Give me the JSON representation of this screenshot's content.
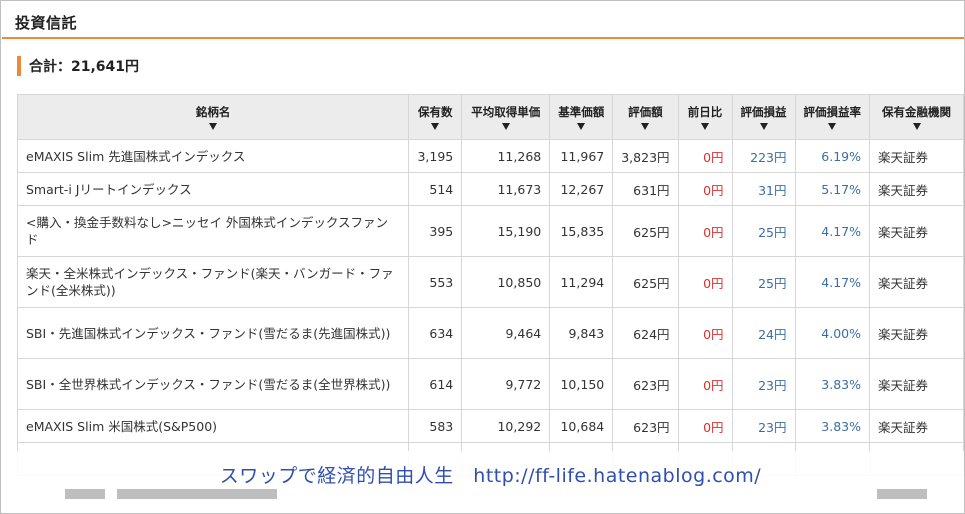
{
  "section": {
    "title": "投資信託"
  },
  "total": {
    "label": "合計：21,641円"
  },
  "columns": [
    "銘柄名",
    "保有数",
    "平均取得単価",
    "基準価額",
    "評価額",
    "前日比",
    "評価損益",
    "評価損益率",
    "保有金融機関"
  ],
  "rows": [
    {
      "name": "eMAXIS Slim 先進国株式インデックス",
      "qty": "3,195",
      "avg": "11,268",
      "nav": "11,967",
      "value": "3,823円",
      "change": "0円",
      "pl": "223円",
      "rate": "6.19%",
      "inst": "楽天証券"
    },
    {
      "name": "Smart-i Jリートインデックス",
      "qty": "514",
      "avg": "11,673",
      "nav": "12,267",
      "value": "631円",
      "change": "0円",
      "pl": "31円",
      "rate": "5.17%",
      "inst": "楽天証券"
    },
    {
      "name": "<購入・換金手数料なし>ニッセイ 外国株式インデックスファンド",
      "qty": "395",
      "avg": "15,190",
      "nav": "15,835",
      "value": "625円",
      "change": "0円",
      "pl": "25円",
      "rate": "4.17%",
      "inst": "楽天証券"
    },
    {
      "name": "楽天・全米株式インデックス・ファンド(楽天・バンガード・ファンド(全米株式))",
      "qty": "553",
      "avg": "10,850",
      "nav": "11,294",
      "value": "625円",
      "change": "0円",
      "pl": "25円",
      "rate": "4.17%",
      "inst": "楽天証券"
    },
    {
      "name": "SBI・先進国株式インデックス・ファンド(雪だるま(先進国株式))",
      "qty": "634",
      "avg": "9,464",
      "nav": "9,843",
      "value": "624円",
      "change": "0円",
      "pl": "24円",
      "rate": "4.00%",
      "inst": "楽天証券"
    },
    {
      "name": "SBI・全世界株式インデックス・ファンド(雪だるま(全世界株式))",
      "qty": "614",
      "avg": "9,772",
      "nav": "10,150",
      "value": "623円",
      "change": "0円",
      "pl": "23円",
      "rate": "3.83%",
      "inst": "楽天証券"
    },
    {
      "name": "eMAXIS Slim 米国株式(S&P500)",
      "qty": "583",
      "avg": "10,292",
      "nav": "10,684",
      "value": "623円",
      "change": "0円",
      "pl": "23円",
      "rate": "3.83%",
      "inst": "楽天証券"
    }
  ],
  "watermark": {
    "text": "スワップで経済的自由人生　http://ff-life.hatenablog.com/"
  },
  "colors": {
    "accent": "#ec8a3a",
    "negative": "#d9322f",
    "positive": "#3a6ea5",
    "watermark": "#2f4faf"
  },
  "icons": {
    "sort": "sort-down-arrow-icon"
  }
}
